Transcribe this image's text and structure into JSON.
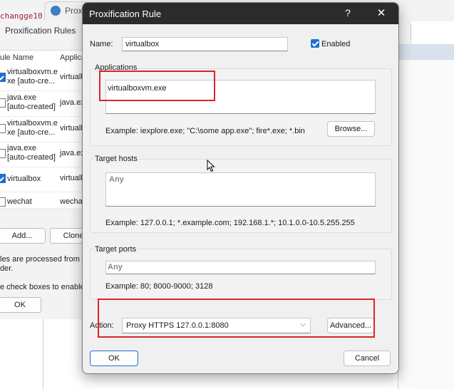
{
  "background": {
    "code_text": "changge10",
    "proxifier_tab_text": "Proxi",
    "rules_window_title": "Proxification Rules",
    "columns": [
      "ule Name",
      "Applica"
    ],
    "rows": [
      {
        "name": "virtualboxvm.e xe [auto-cre...",
        "app": "virtualb",
        "checked": true
      },
      {
        "name": "java.exe [auto-created]",
        "app": "java.ex",
        "checked": false
      },
      {
        "name": "virtualboxvm.e xe [auto-cre...",
        "app": "virtualb",
        "checked": false
      },
      {
        "name": "java.exe [auto-created]",
        "app": "java.ex",
        "checked": false
      },
      {
        "name": "virtualbox",
        "app": "virtualb",
        "checked": true
      },
      {
        "name": "wechat",
        "app": "wechat",
        "checked": false
      }
    ],
    "add_button": "Add...",
    "clone_button": "Clone",
    "note1_line1": "les are processed from to",
    "note1_line2": "der.",
    "note2": "e check boxes to enable/d",
    "ok_button": "OK"
  },
  "dialog": {
    "title": "Proxification Rule",
    "help_glyph": "?",
    "close_glyph": "✕",
    "name_label": "Name:",
    "name_value": "virtualbox",
    "enabled_label": "Enabled",
    "enabled": true,
    "applications_title": "Applications",
    "applications_value": "virtualboxvm.exe",
    "applications_example": "Example: iexplore.exe; \"C:\\some app.exe\"; fire*.exe; *.bin",
    "browse_button": "Browse...",
    "target_hosts_title": "Target hosts",
    "target_hosts_value": "Any",
    "target_hosts_example": "Example: 127.0.0.1; *.example.com; 192.168.1.*; 10.1.0.0-10.5.255.255",
    "target_ports_title": "Target ports",
    "target_ports_value": "Any",
    "target_ports_example": "Example: 80; 8000-9000; 3128",
    "action_label": "Action:",
    "action_value": "Proxy HTTPS 127.0.0.1:8080",
    "advanced_button": "Advanced...",
    "ok_button": "OK",
    "cancel_button": "Cancel"
  },
  "colors": {
    "annotation_red": "#d9252a",
    "accent_blue": "#1f6fd0",
    "titlebar": "#2b2b2b"
  }
}
